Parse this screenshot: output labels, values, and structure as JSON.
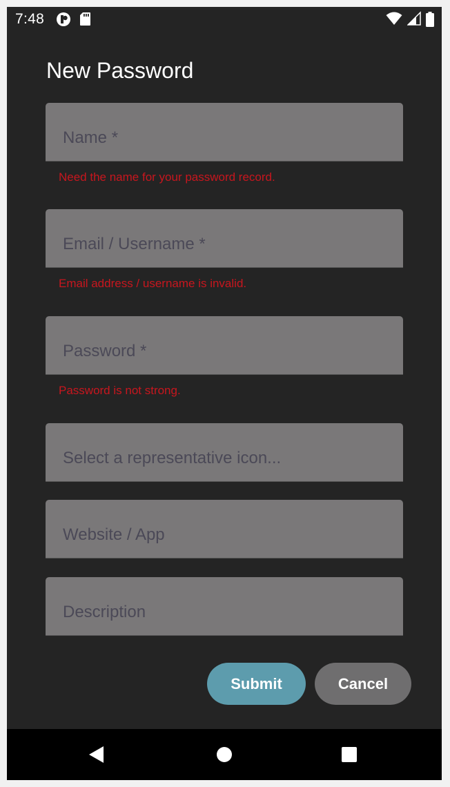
{
  "status_bar": {
    "time": "7:48",
    "left_icons": [
      "app-notification-icon",
      "sd-card-icon"
    ],
    "right_icons": [
      "wifi-icon",
      "cell-signal-icon",
      "battery-icon"
    ]
  },
  "page": {
    "title": "New Password"
  },
  "form": {
    "name": {
      "placeholder": "Name *",
      "value": "",
      "error": "Need the name for your password record."
    },
    "email": {
      "placeholder": "Email / Username *",
      "value": "",
      "error": "Email address / username is invalid."
    },
    "password": {
      "placeholder": "Password *",
      "value": "",
      "error": "Password is not strong."
    },
    "icon": {
      "placeholder": "Select a representative icon...",
      "value": ""
    },
    "website": {
      "placeholder": "Website / App",
      "value": ""
    },
    "description": {
      "placeholder": "Description",
      "value": ""
    }
  },
  "actions": {
    "submit_label": "Submit",
    "cancel_label": "Cancel"
  },
  "nav_bar": {
    "icons": [
      "back-triangle-icon",
      "home-circle-icon",
      "recents-square-icon"
    ]
  },
  "colors": {
    "background": "#242424",
    "field": "#7a7879",
    "error": "#c8161e",
    "submit": "#5d9cad",
    "cancel": "#6f6e6f"
  }
}
